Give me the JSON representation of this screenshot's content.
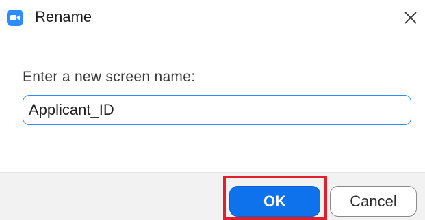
{
  "window": {
    "title": "Rename",
    "app_icon": "zoom-camera-icon",
    "close_icon": "close-icon"
  },
  "form": {
    "prompt": "Enter a new screen name:",
    "name_value": "Applicant_ID"
  },
  "buttons": {
    "ok_label": "OK",
    "cancel_label": "Cancel"
  },
  "colors": {
    "accent": "#2D8CFF",
    "ok_button": "#0E72ED",
    "highlight": "#E0202A",
    "footer": "#F2F2F2"
  }
}
